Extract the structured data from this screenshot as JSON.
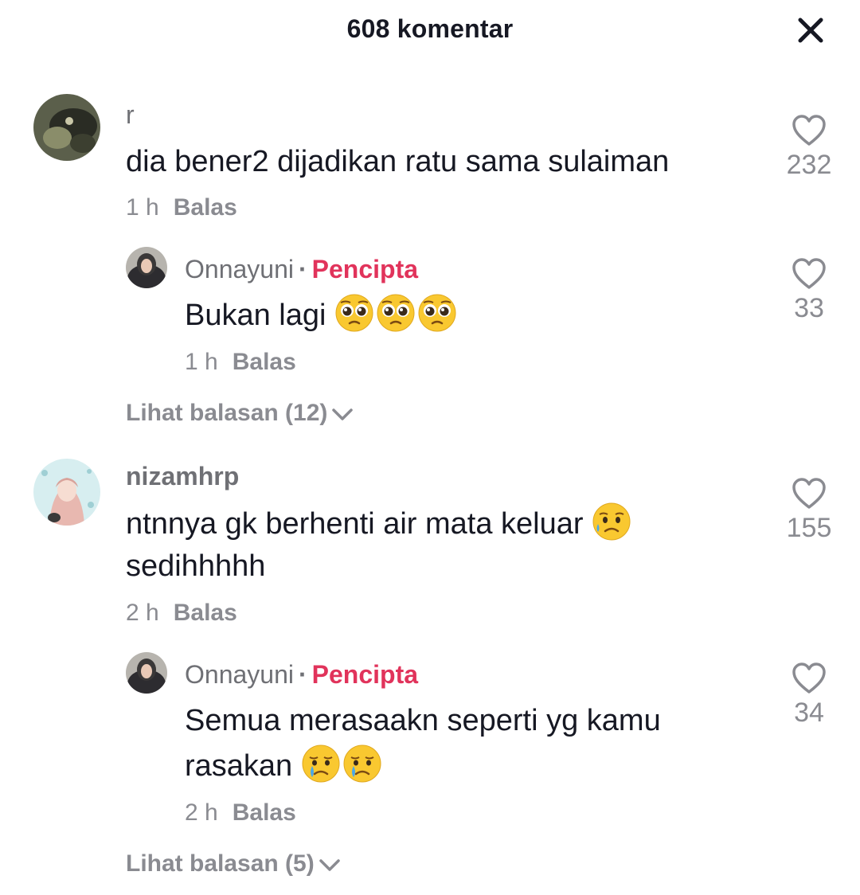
{
  "header": {
    "title": "608 komentar"
  },
  "comments": [
    {
      "username": "r",
      "text": "dia bener2 dijadikan ratu sama sulaiman",
      "time": "1 h",
      "reply_label": "Balas",
      "likes": "232",
      "reply": {
        "username": "Onnayuni",
        "badge": "Pencipta",
        "text": "Bukan lagi",
        "emojis": [
          "pleading-face",
          "pleading-face",
          "pleading-face"
        ],
        "time": "1 h",
        "reply_label": "Balas",
        "likes": "33"
      },
      "view_replies": "Lihat balasan (12)"
    },
    {
      "username": "nizamhrp",
      "text": "ntnnya gk berhenti air mata keluar",
      "text_line2": "sedihhhhh",
      "emojis": [
        "sad-but-relieved-face"
      ],
      "time": "2 h",
      "reply_label": "Balas",
      "likes": "155",
      "reply": {
        "username": "Onnayuni",
        "badge": "Pencipta",
        "text": "Semua merasaakn seperti yg kamu",
        "text_line2": "rasakan",
        "emojis": [
          "crying-face",
          "crying-face"
        ],
        "time": "2 h",
        "reply_label": "Balas",
        "likes": "34"
      },
      "view_replies": "Lihat balasan (5)"
    }
  ],
  "colors": {
    "creator_badge": "#e1335b",
    "muted": "#8a8b91",
    "text": "#161823"
  },
  "icons": {
    "close": "close-icon",
    "like": "heart-outline-icon",
    "expand": "chevron-down-icon"
  }
}
